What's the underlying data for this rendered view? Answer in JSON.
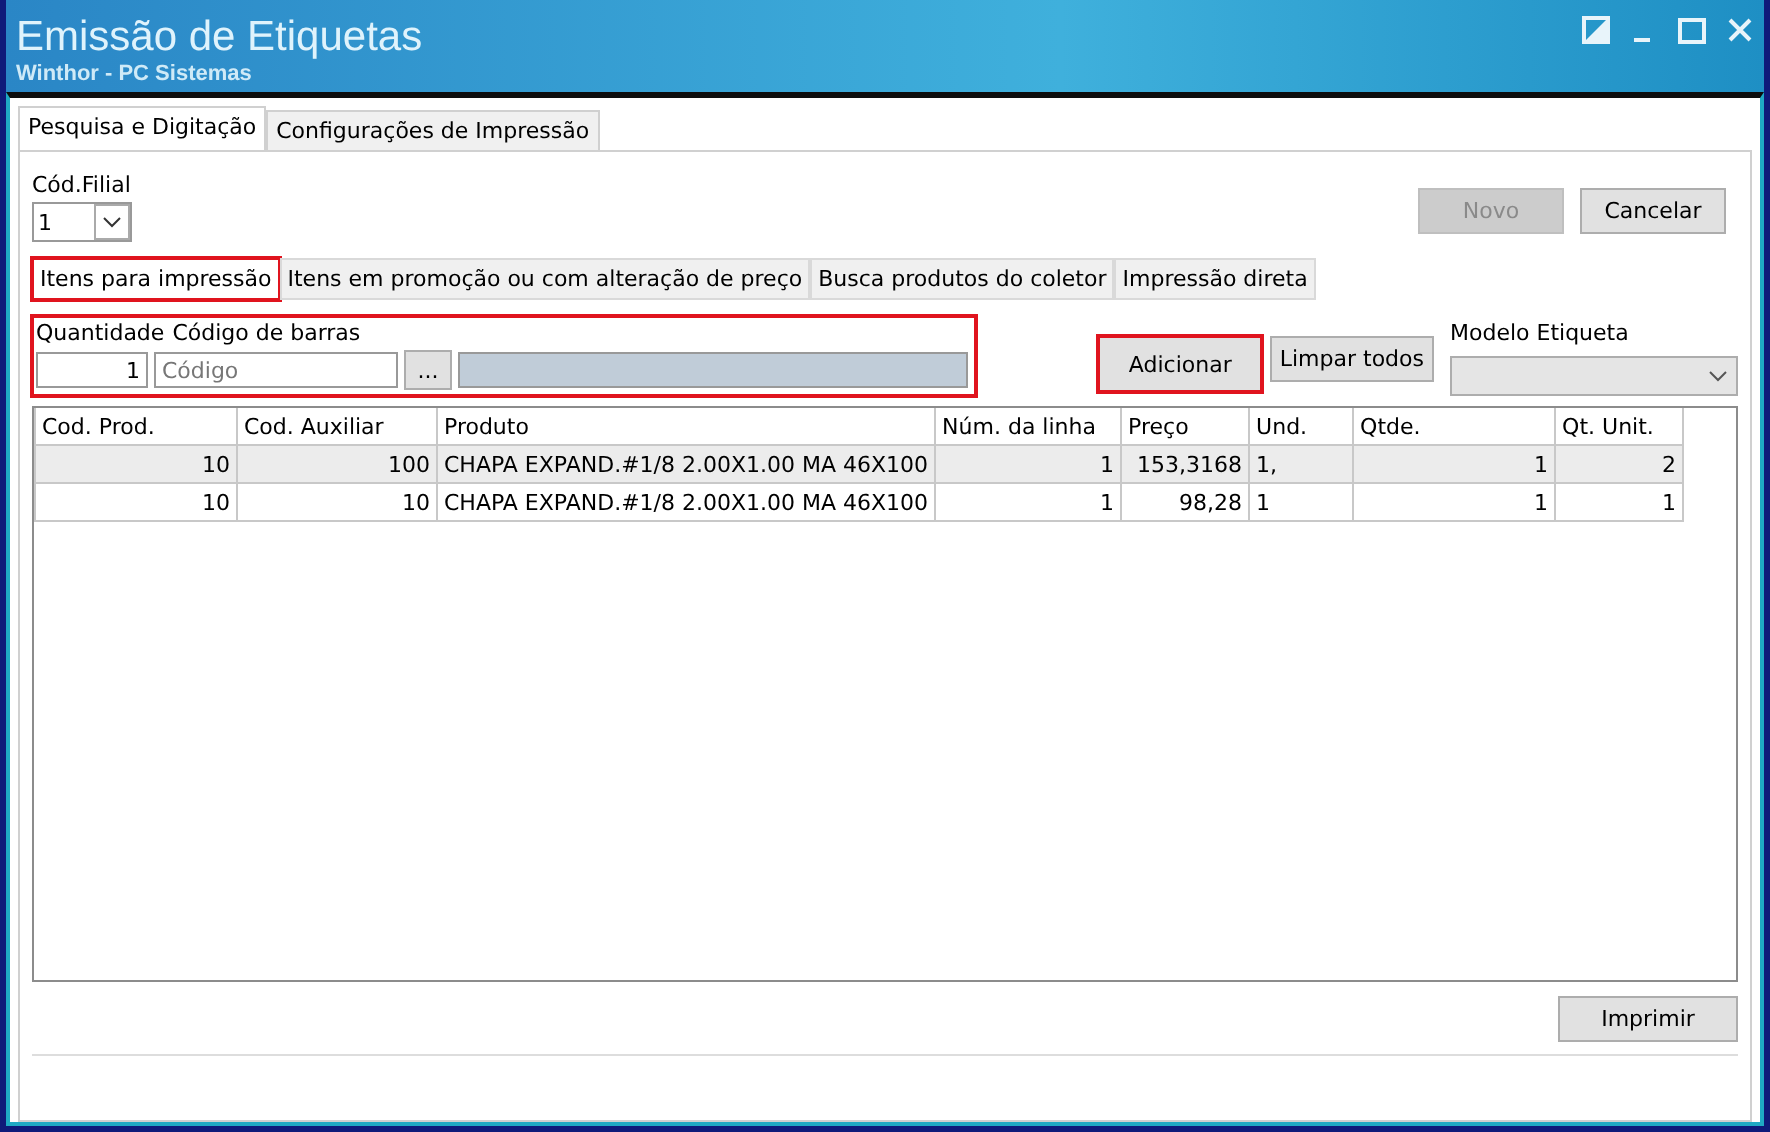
{
  "window": {
    "title": "Emissão de Etiquetas",
    "subtitle": "Winthor - PC Sistemas"
  },
  "tabs": [
    {
      "label": "Pesquisa e Digitação",
      "selected": true
    },
    {
      "label": "Configurações de Impressão",
      "selected": false
    }
  ],
  "filial": {
    "label": "Cód.Filial",
    "value": "1"
  },
  "top_buttons": [
    {
      "label": "Novo",
      "disabled": true
    },
    {
      "label": "Cancelar",
      "disabled": false
    }
  ],
  "inner_tabs": [
    {
      "label": "Itens para impressão",
      "selected": true,
      "highlighted": true
    },
    {
      "label": "Itens em promoção ou com alteração de preço",
      "selected": false,
      "highlighted": false
    },
    {
      "label": "Busca produtos do coletor",
      "selected": false,
      "highlighted": false
    },
    {
      "label": "Impressão direta",
      "selected": false,
      "highlighted": false
    }
  ],
  "entry": {
    "highlighted": true,
    "quantity_label": "Quantidade",
    "quantity": "1",
    "barcode_label": "Código de barras",
    "barcode_placeholder": "Código",
    "browse_button": "..."
  },
  "actions": [
    {
      "label": "Adicionar",
      "highlighted": true
    },
    {
      "label": "Limpar todos",
      "highlighted": false
    }
  ],
  "modelo": {
    "label": "Modelo Etiqueta"
  },
  "table": {
    "columns": [
      "Cod. Prod.",
      "Cod. Auxiliar",
      "Produto",
      "Núm. da linha",
      "Preço",
      "Und.",
      "Qtde.",
      "Qt. Unit."
    ],
    "rows": [
      {
        "selected": true,
        "cells": [
          "10",
          "100",
          "CHAPA  EXPAND.#1/8 2.00X1.00 MA 46X100",
          "1",
          "153,3168",
          "1,",
          "1",
          "2"
        ]
      },
      {
        "selected": false,
        "cells": [
          "10",
          "10",
          "CHAPA  EXPAND.#1/8 2.00X1.00 MA 46X100",
          "1",
          "98,28",
          "1",
          "1",
          "1"
        ]
      }
    ]
  },
  "print_button": "Imprimir"
}
